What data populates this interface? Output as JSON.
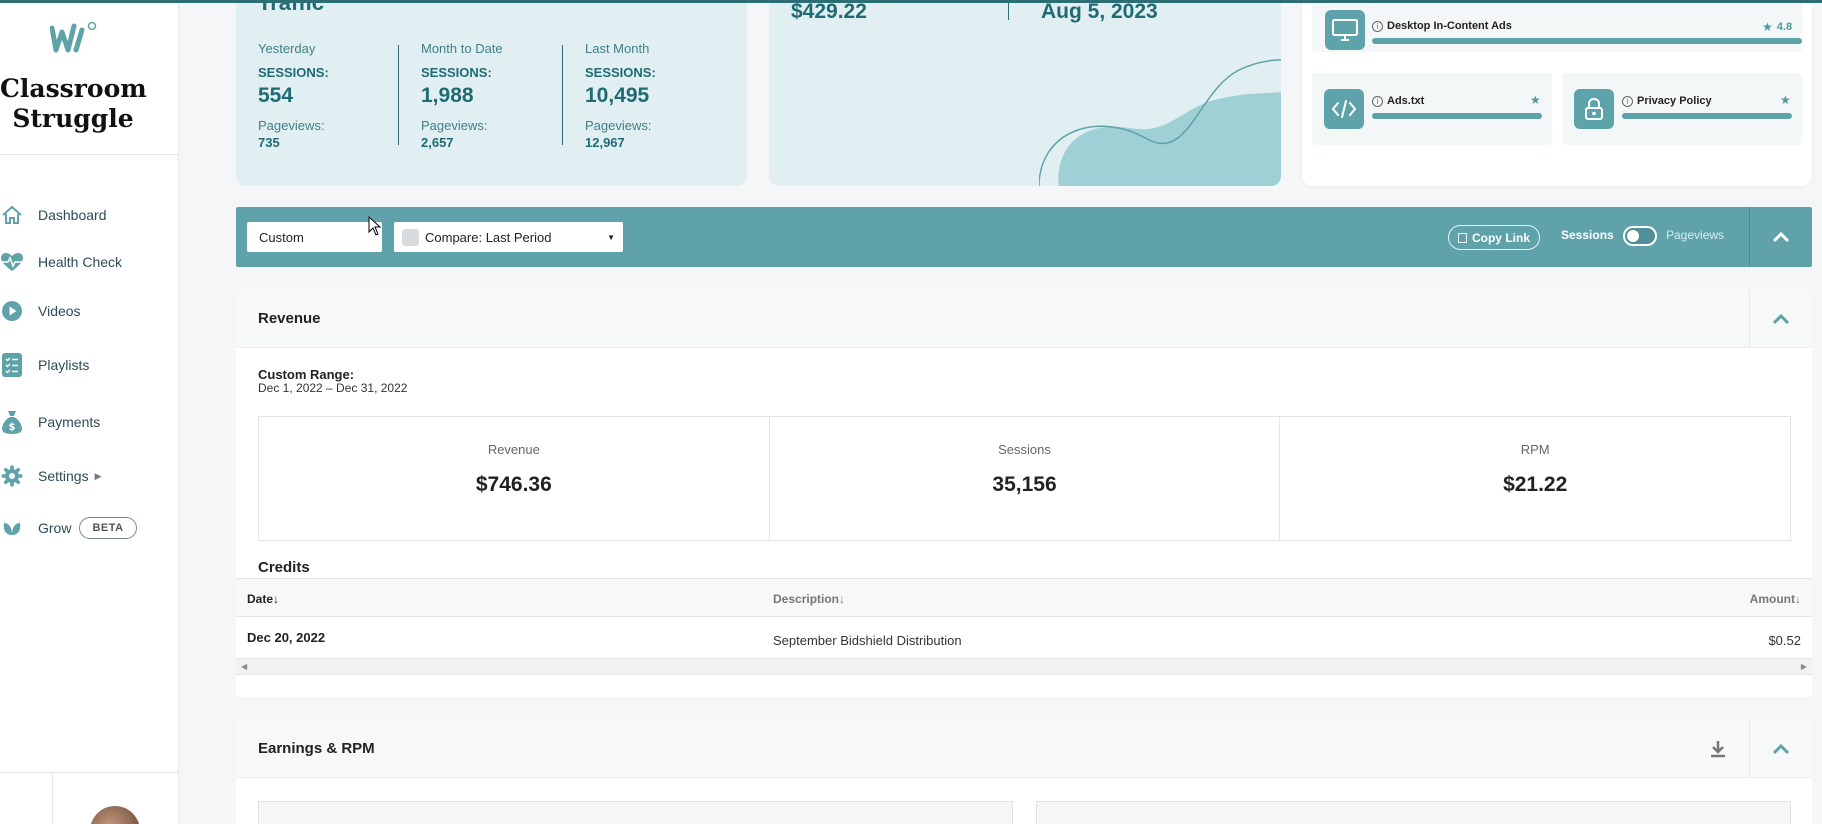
{
  "app": {
    "name_line1": "Classroom",
    "name_line2": "Struggle"
  },
  "sidebar": {
    "items": [
      {
        "label": "Dashboard",
        "icon": "home-icon"
      },
      {
        "label": "Health Check",
        "icon": "heartbeat-icon"
      },
      {
        "label": "Videos",
        "icon": "play-circle-icon"
      },
      {
        "label": "Playlists",
        "icon": "list-icon"
      },
      {
        "label": "Payments",
        "icon": "money-bag-icon"
      },
      {
        "label": "Settings",
        "icon": "gear-icon"
      },
      {
        "label": "Grow",
        "icon": "leaf-icon",
        "badge": "BETA"
      }
    ]
  },
  "traffic": {
    "title": "Traffic",
    "columns": [
      {
        "period": "Yesterday",
        "sessions_label": "SESSIONS:",
        "sessions": "554",
        "pageviews_label": "Pageviews:",
        "pageviews": "735"
      },
      {
        "period": "Month to Date",
        "sessions_label": "SESSIONS:",
        "sessions": "1,988",
        "pageviews_label": "Pageviews:",
        "pageviews": "2,657"
      },
      {
        "period": "Last Month",
        "sessions_label": "SESSIONS:",
        "sessions": "10,495",
        "pageviews_label": "Pageviews:",
        "pageviews": "12,967"
      }
    ]
  },
  "earnings_card": {
    "amount": "$429.22",
    "date": "Aug 5, 2023"
  },
  "health_check": {
    "items": [
      {
        "label": "Desktop In-Content Ads",
        "score": "4.8",
        "icon": "monitor-icon"
      },
      {
        "label": "Ads.txt",
        "icon": "code-icon"
      },
      {
        "label": "Privacy Policy",
        "icon": "lock-icon"
      }
    ]
  },
  "filterbar": {
    "date_select": "Custom",
    "compare_select": "Compare: Last Period",
    "copy_link": "Copy Link",
    "toggle_left": "Sessions",
    "toggle_right": "Pageviews"
  },
  "revenue": {
    "title": "Revenue",
    "range_label": "Custom Range:",
    "range_value": "Dec 1, 2022 – Dec 31, 2022",
    "stats": [
      {
        "label": "Revenue",
        "value": "$746.36"
      },
      {
        "label": "Sessions",
        "value": "35,156"
      },
      {
        "label": "RPM",
        "value": "$21.22"
      }
    ],
    "credits_title": "Credits",
    "table": {
      "headers": {
        "date": "Date↓",
        "description": "Description↓",
        "amount": "Amount↓"
      },
      "rows": [
        {
          "date": "Dec 20, 2022",
          "description": "September Bidshield Distribution",
          "amount": "$0.52"
        }
      ]
    }
  },
  "earnings_rpm": {
    "title": "Earnings & RPM"
  },
  "colors": {
    "teal": "#5fa2aa",
    "teal_dark": "#1e6b74",
    "card_bg": "#e1eff2"
  }
}
